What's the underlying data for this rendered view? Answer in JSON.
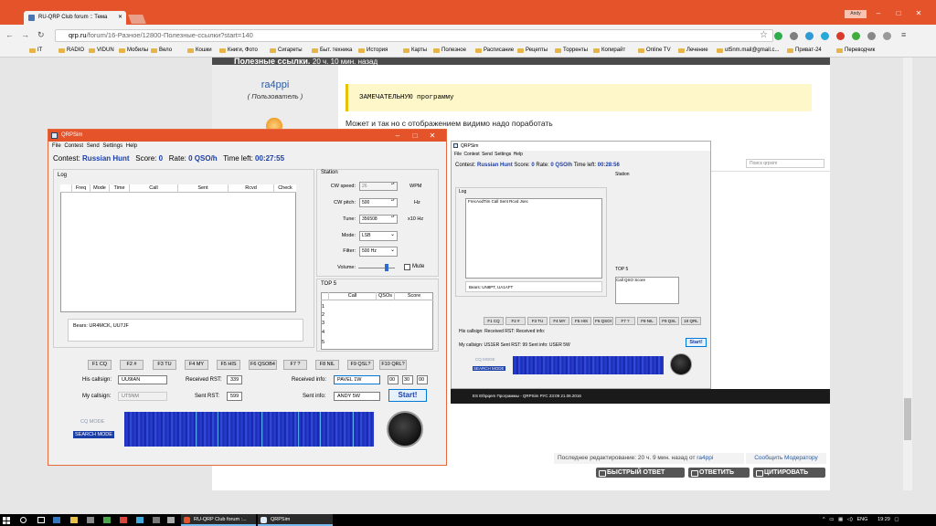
{
  "browser": {
    "tab_title": "RU-QRP Club forum :: Тема",
    "user": "Andy",
    "url_domain": "qrp.ru",
    "url_path": "/forum/16-Разное/12800-Полезные-ссылки?start=140",
    "bookmarks": [
      "IT",
      "RADIO",
      "VIDUN",
      "Мобилы",
      "Вело",
      "Кошки",
      "Книги, Фото",
      "Сигареты",
      "Быт. техника",
      "История",
      "Карты",
      "Полезное",
      "Расписание",
      "Рецепты",
      "Торренты",
      "Копирайт",
      "Online TV",
      "Лечение",
      "ut5nm.mail@gmail.c...",
      "Приват-24",
      "Переводчик"
    ]
  },
  "forum": {
    "topic_title": "Полезные ссылки.",
    "topic_time": "20 ч. 10 мин. назад",
    "username": "ra4ppi",
    "user_role": "( Пользователь )",
    "quote": "ЗАМЕЧАТЕЛЬНУЮ программу",
    "post_text": "Может и так но с отображением видимо надо поработать",
    "edit_note": "Последнее редактирование: 20 ч. 9 мин. назад от",
    "edit_by": "ra4ppi",
    "moderator_btn": "Сообщить Модератору",
    "reply_quick": "БЫСТРЫЙ ОТВЕТ",
    "reply": "ОТВЕТИТЬ",
    "quote_btn": "ЦИТИРОВАТЬ"
  },
  "qrpsim": {
    "title": "QRPSim",
    "menu": [
      "File",
      "Contest",
      "Send",
      "Settings",
      "Help"
    ],
    "contest_label": "Contest:",
    "contest": "Russian Hunt",
    "score_label": "Score:",
    "score": "0",
    "rate_label": "Rate:",
    "rate": "0 QSO/h",
    "timeleft_label": "Time left:",
    "timeleft": "00:27:55",
    "log_label": "Log",
    "log_cols": [
      "Freq",
      "Mode",
      "Time",
      "Call",
      "Sent",
      "Rcvd",
      "Check"
    ],
    "bears": "Bears: UR4MCK, UU7JF",
    "station_label": "Station",
    "cw_speed_label": "CW speed:",
    "cw_speed": "26",
    "wpm": "WPM",
    "cw_pitch_label": "CW pitch:",
    "cw_pitch": "500",
    "hz": "Hz",
    "tune_label": "Tune:",
    "tune": "356508",
    "x10hz": "x10 Hz",
    "mode_label": "Mode:",
    "mode": "LSB",
    "filter_label": "Filter:",
    "filter": "500 Hz",
    "volume_label": "Volume:",
    "mute": "Mute",
    "top5_label": "TOP 5",
    "top5_cols": [
      "Call",
      "QSOs",
      "Score"
    ],
    "top5_rows": [
      "1",
      "2",
      "3",
      "4",
      "5"
    ],
    "fkeys": [
      "F1 CQ",
      "F2 #",
      "F3 TU",
      "F4 MY",
      "F5 HIS",
      "F6 QSOB4",
      "F7 ?",
      "F8 NIL",
      "F9 QSL?",
      "F10 QRL?"
    ],
    "his_call_label": "His callsign:",
    "his_call": "UU9IAN",
    "rcvd_rst_label": "Received RST:",
    "rcvd_rst": "339",
    "rcvd_info_label": "Received info:",
    "rcvd_info": "PAVEL 1W",
    "time_h": "00",
    "time_m": "30",
    "time_s": "00",
    "my_call_label": "My callsign:",
    "my_call": "UT5NM",
    "sent_rst_label": "Sent RST:",
    "sent_rst": "599",
    "sent_info_label": "Sent info:",
    "sent_info": "ANDY 5W",
    "start": "Start!",
    "cq_mode": "CQ MODE",
    "search_mode": "SEARCH MODE"
  },
  "qrpsim_shot": {
    "title": "QRPSim",
    "menu": [
      "File",
      "Contest",
      "Send",
      "Settings",
      "Help"
    ],
    "contest": "Russian Hunt",
    "score": "0",
    "rate": "0 QSO/h",
    "timeleft": "00:28:56",
    "log_label": "Log",
    "log_cols": "FrecAodTim  Call   Sent   Rcvd  Jsec",
    "bears": "Bears: UN8PT, UA1AFT",
    "station": "Station",
    "top5": "TOP 5",
    "top5_cols": "Call   QSO  Score",
    "fkeys": [
      "F1 CQ",
      "F2 #",
      "F3 TU",
      "F4 MY",
      "F5 HIS",
      "F6 QSOI",
      "F7 ?",
      "F8 NIL",
      "F9 QSL",
      "10 QRL"
    ],
    "row1": "His callsign:          Received RST:          Received info:",
    "row2": "My callsign:   US1ER   Sent RST:  99   Sent info:  USER 5W",
    "start": "Start!",
    "cq_mode": "CQ MODE",
    "search_mode": "SEARCH MODE",
    "search_placeholder": "Поиск qrpsim",
    "taskbar": "ES      Ethpqem      Программы -      QRPSim      РУС  23:09  21.06.2016"
  },
  "taskbar": {
    "app1": "RU-QRP Club forum :...",
    "app2": "QRPSim",
    "lang": "ENG",
    "time": "19:29"
  },
  "colors": {
    "titlebar": "#e4532a",
    "accent_blue": "#1a3ea8",
    "forum_link": "#2a5aa0"
  }
}
